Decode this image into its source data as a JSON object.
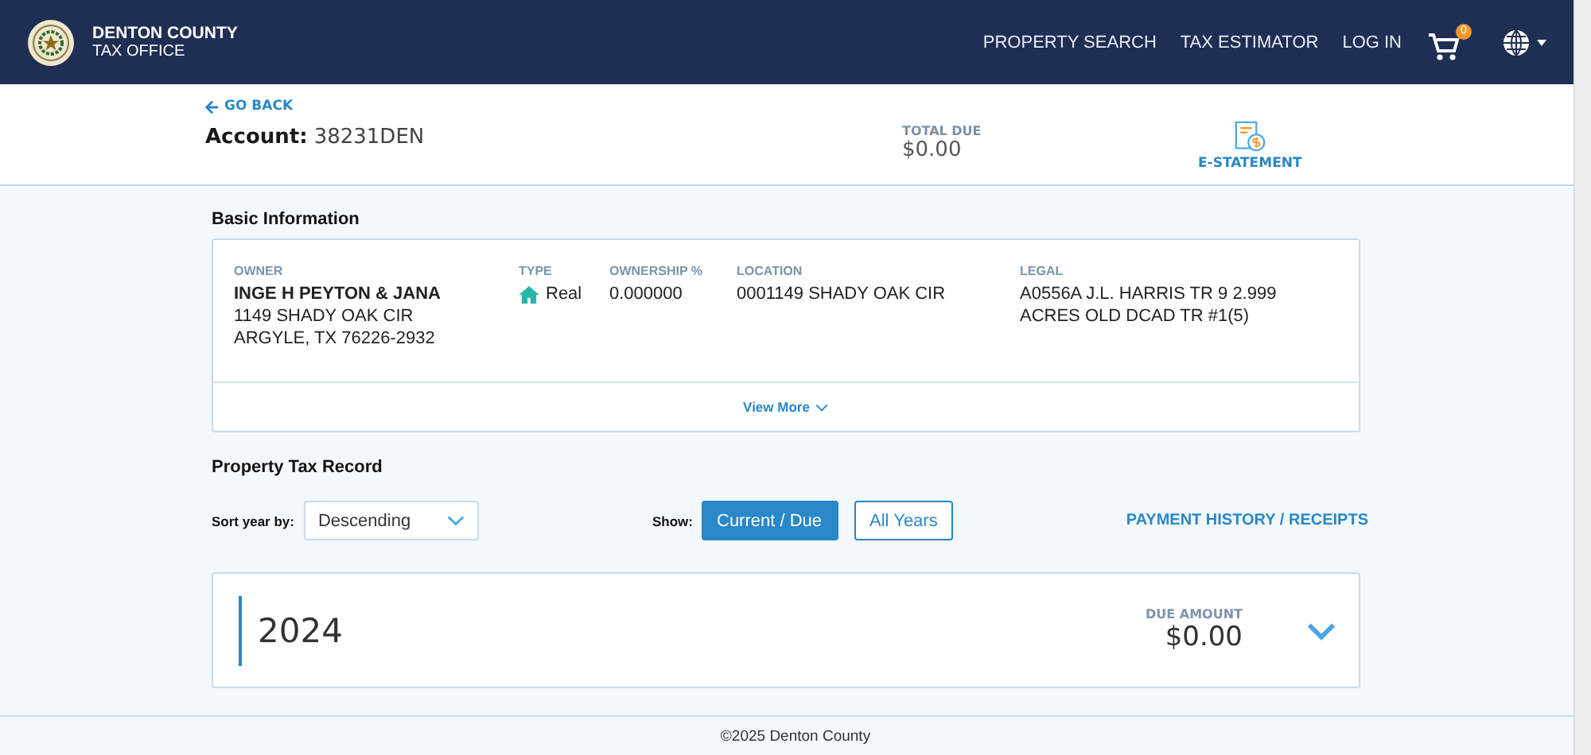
{
  "header": {
    "brand_line1": "DENTON COUNTY",
    "brand_line2": "TAX OFFICE",
    "nav": [
      "PROPERTY SEARCH",
      "TAX ESTIMATOR",
      "LOG IN"
    ],
    "cart_count": "0"
  },
  "account": {
    "back": "GO BACK",
    "label": "Account:",
    "number": "38231DEN",
    "total_due_label": "TOTAL DUE",
    "total_due": "$0.00",
    "estatement": "E-STATEMENT"
  },
  "basic_info": {
    "title": "Basic Information",
    "columns": [
      {
        "label": "OWNER",
        "lines": [
          "INGE H PEYTON & JANA",
          "1149 SHADY OAK CIR",
          "ARGYLE, TX 76226-2932"
        ],
        "kind": "owner"
      },
      {
        "label": "TYPE",
        "lines": [
          "Real"
        ],
        "kind": "type"
      },
      {
        "label": "OWNERSHIP %",
        "lines": [
          "0.000000"
        ],
        "kind": "plain"
      },
      {
        "label": "LOCATION",
        "lines": [
          "0001149 SHADY OAK CIR"
        ],
        "kind": "plain"
      },
      {
        "label": "LEGAL",
        "lines": [
          "A0556A J.L. HARRIS TR 9 2.999",
          "ACRES OLD DCAD TR #1(5)"
        ],
        "kind": "plain"
      }
    ],
    "view_more": "View More"
  },
  "tax_record": {
    "title": "Property Tax Record",
    "sort_label": "Sort year by:",
    "sort_value": "Descending",
    "show_label": "Show:",
    "show_options": [
      {
        "label": "Current / Due",
        "selected": true
      },
      {
        "label": "All Years",
        "selected": false
      }
    ],
    "history_link": "PAYMENT HISTORY / RECEIPTS",
    "years": [
      {
        "year": "2024",
        "due_label": "DUE AMOUNT",
        "due": "$0.00",
        "expanded": false
      }
    ]
  },
  "footer": "©2025 Denton County"
}
